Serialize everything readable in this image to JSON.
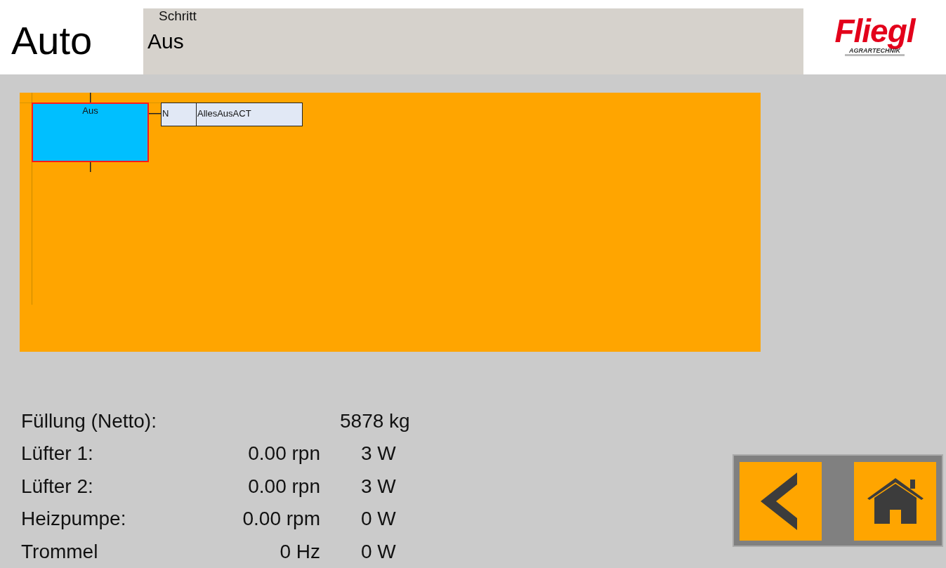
{
  "header": {
    "title": "Auto",
    "step_field": {
      "label": "Schritt",
      "value": "Aus"
    },
    "logo": {
      "name": "Fliegl",
      "tagline": "AGRARTECHNIK"
    }
  },
  "diagram": {
    "step": {
      "name": "Aus",
      "active": true
    },
    "action": {
      "qualifier": "N",
      "name": "AllesAusACT"
    }
  },
  "readings": [
    {
      "kind": "total",
      "label": "Füllung (Netto):",
      "value": "5878 kg"
    },
    {
      "kind": "drive",
      "label": "Lüfter 1:",
      "speed": "0.00 rpn",
      "power": "3 W"
    },
    {
      "kind": "drive",
      "label": "Lüfter 2:",
      "speed": "0.00 rpn",
      "power": "3 W"
    },
    {
      "kind": "drive",
      "label": "Heizpumpe:",
      "speed": "0.00 rpm",
      "power": "0 W"
    },
    {
      "kind": "drive",
      "label": "Trommel",
      "speed": "0 Hz",
      "power": "0 W"
    }
  ],
  "nav": [
    {
      "kind": "back"
    },
    {
      "kind": "home"
    }
  ]
}
